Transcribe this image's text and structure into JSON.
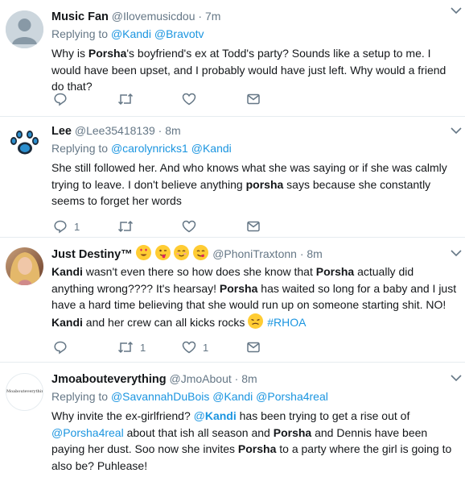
{
  "tweets": [
    {
      "name": "Music Fan",
      "handle": "@Ilovemusicdou",
      "time": "7m",
      "reply_prefix": "Replying to",
      "mentions": [
        "@Kandi",
        "@Bravotv"
      ],
      "text_parts": [
        {
          "t": "Why is "
        },
        {
          "t": "Porsha",
          "b": true
        },
        {
          "t": "'s boyfriend's ex at Todd's party? Sounds like a setup to me. I would have been upset, and I probably would have just left. Why would a friend do that?"
        }
      ],
      "reply_count": "",
      "retweet_count": "",
      "like_count": "",
      "avatar": "default-avatar"
    },
    {
      "name": "Lee",
      "handle": "@Lee35418139",
      "time": "8m",
      "reply_prefix": "Replying to",
      "mentions": [
        "@carolynricks1",
        "@Kandi"
      ],
      "text_parts": [
        {
          "t": "She still followed her. And who knows what she was saying or if she was calmly trying to leave. I don't believe anything "
        },
        {
          "t": "porsha",
          "b": true
        },
        {
          "t": " says because she constantly seems to forget her words"
        }
      ],
      "reply_count": "1",
      "retweet_count": "",
      "like_count": "",
      "avatar": "paw-print-avatar"
    },
    {
      "name": "Just Destiny™",
      "handle": "@PhoniTraxtonn",
      "time": "8m",
      "name_emojis": [
        "heart-eyes-emoji",
        "winking-tongue-emoji",
        "smiling-emoji",
        "yum-emoji"
      ],
      "reply_prefix": "",
      "mentions": [],
      "text_parts": [
        {
          "t": "Kandi",
          "b": true
        },
        {
          "t": " wasn't even there so how does she know that "
        },
        {
          "t": "Porsha",
          "b": true
        },
        {
          "t": " actually did anything wrong???? It's hearsay! "
        },
        {
          "t": "Porsha",
          "b": true
        },
        {
          "t": " has waited so long for a baby and I just have a hard time believing that she would run up on someone starting shit. NO! "
        },
        {
          "t": "Kandi",
          "b": true
        },
        {
          "t": " and her crew can all kicks rocks "
        },
        {
          "emoji": "persevering-face-emoji"
        },
        {
          "t": " "
        },
        {
          "t": "#RHOA",
          "link": true
        }
      ],
      "reply_count": "",
      "retweet_count": "1",
      "like_count": "1",
      "avatar": "photo-avatar"
    },
    {
      "name": "Jmoabouteverything",
      "handle": "@JmoAbout",
      "time": "8m",
      "reply_prefix": "Replying to",
      "mentions": [
        "@SavannahDuBois",
        "@Kandi",
        "@Porsha4real"
      ],
      "text_parts": [
        {
          "t": "Why invite the ex-girlfriend? "
        },
        {
          "t": "@",
          "link": true
        },
        {
          "t": "Kandi",
          "b": true,
          "link": true
        },
        {
          "t": " has been trying to get a rise out of "
        },
        {
          "t": "@Porsha4real",
          "link": true
        },
        {
          "t": " about that ish all season and "
        },
        {
          "t": "Porsha",
          "b": true
        },
        {
          "t": " and Dennis have been paying her dust.  Soo now she invites "
        },
        {
          "t": "Porsha",
          "b": true
        },
        {
          "t": " to a party where the girl is going to also be? Puhlease!"
        }
      ],
      "avatar_text": "Moabouteverything",
      "avatar": "text-avatar"
    }
  ],
  "colors": {
    "muted": "#657786",
    "link": "#1b95e0",
    "text": "#14171a",
    "border": "#e6ecf0"
  }
}
